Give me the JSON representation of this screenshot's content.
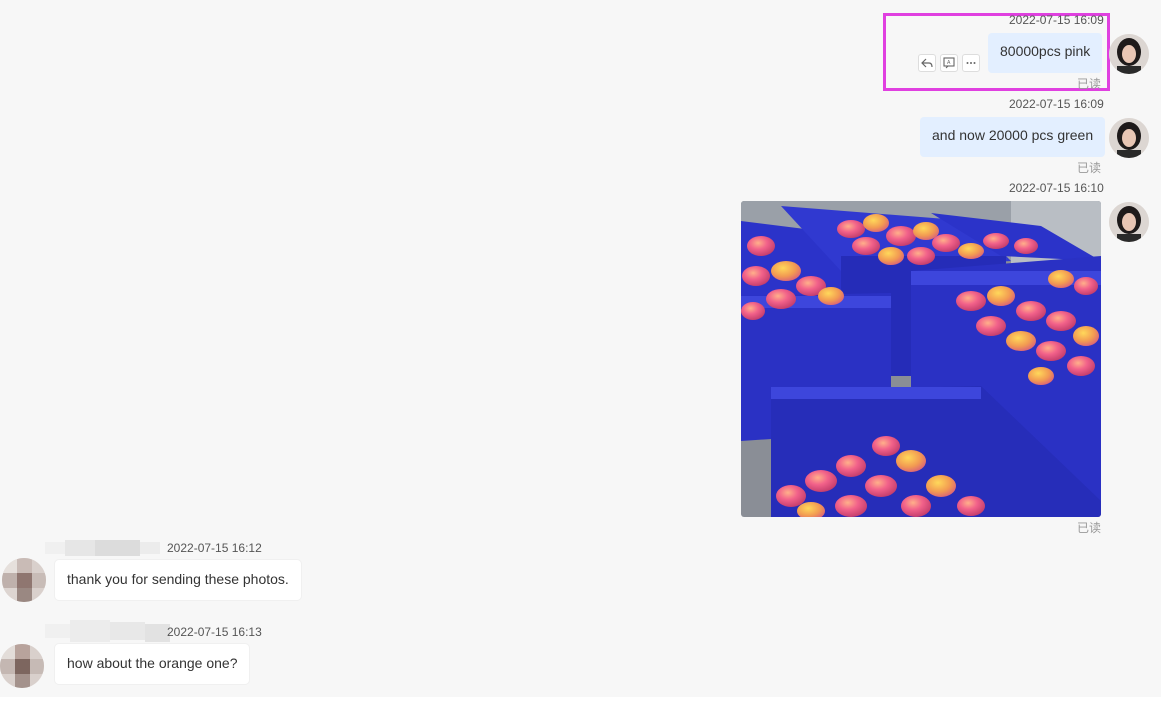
{
  "messages": {
    "m1": {
      "timestamp": "2022-07-15 16:09",
      "text": "80000pcs pink",
      "status": "已读"
    },
    "m2": {
      "timestamp": "2022-07-15 16:09",
      "text": "and now 20000 pcs green",
      "status": "已读"
    },
    "m3": {
      "timestamp": "2022-07-15 16:10",
      "status": "已读"
    },
    "m4": {
      "timestamp": "2022-07-15 16:12",
      "text": "thank you for sending these photos."
    },
    "m5": {
      "timestamp": "2022-07-15 16:13",
      "text": "how about the orange one?"
    }
  },
  "icons": {
    "reply": "reply-icon",
    "quote": "quote-icon",
    "more": "more-icon"
  },
  "colors": {
    "highlight": "#e040e0",
    "outgoing_bubble": "#e3efff",
    "incoming_bubble": "#ffffff",
    "crate_blue": "#2b33c9"
  }
}
